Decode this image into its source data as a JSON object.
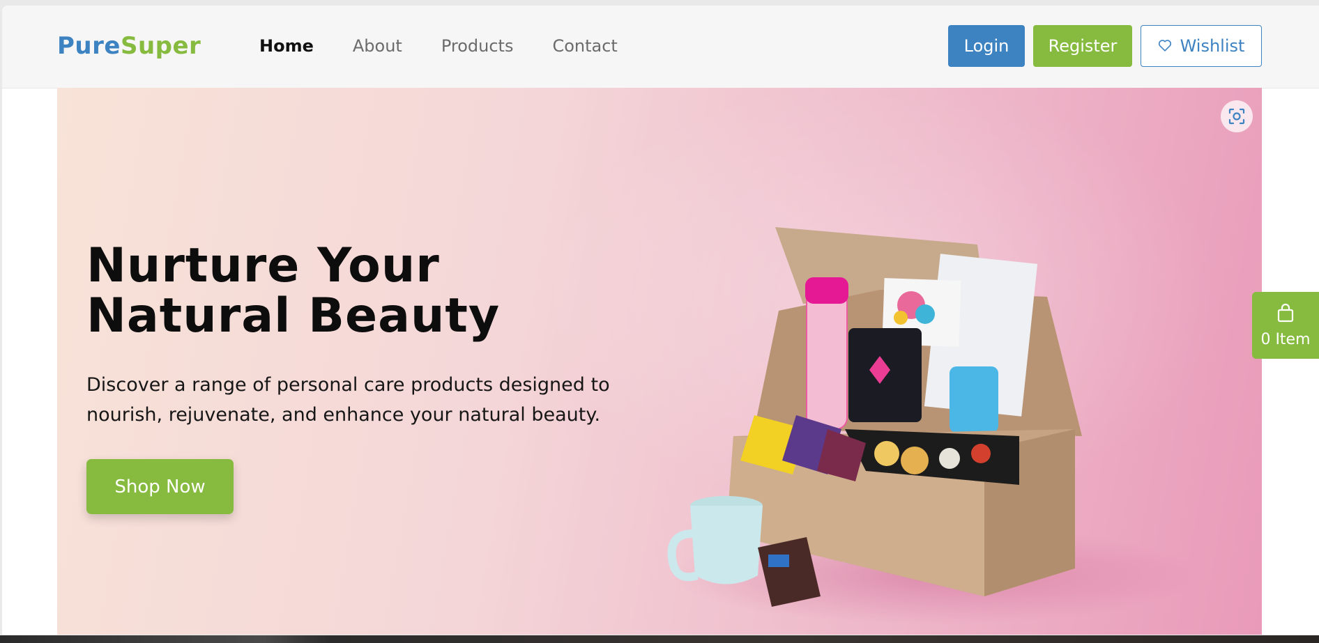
{
  "brand": {
    "part1": "Pure",
    "part2": "Super",
    "color1": "#3d83c2",
    "color2": "#86bb3f"
  },
  "nav": [
    {
      "label": "Home",
      "active": true
    },
    {
      "label": "About",
      "active": false
    },
    {
      "label": "Products",
      "active": false
    },
    {
      "label": "Contact",
      "active": false
    }
  ],
  "actions": {
    "login": "Login",
    "register": "Register",
    "wishlist": "Wishlist"
  },
  "hero": {
    "title": "Nurture Your Natural Beauty",
    "description": "Discover a range of personal care products designed to nourish, rejuvenate, and enhance your natural beauty.",
    "cta": "Shop Now"
  },
  "cart": {
    "label": "0 Item"
  },
  "icons": {
    "wishlist": "heart-icon",
    "cart": "shopping-bag-icon",
    "lens": "screen-capture-icon"
  },
  "colors": {
    "primary": "#3d83c2",
    "accent": "#86bb3f"
  }
}
